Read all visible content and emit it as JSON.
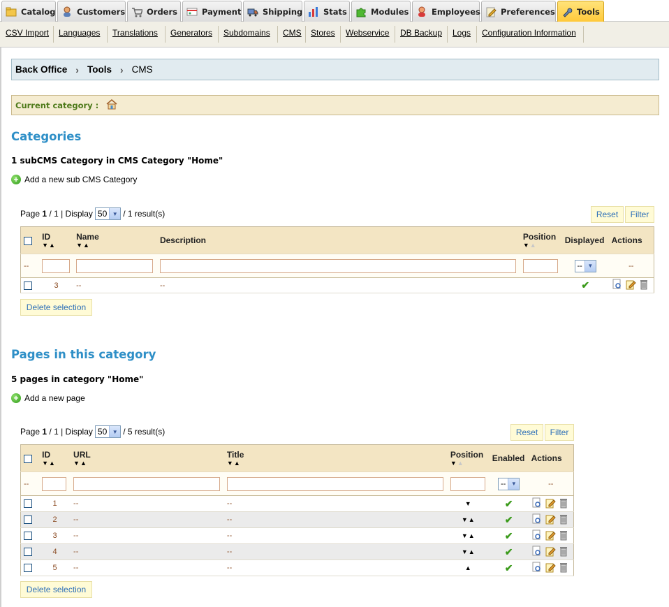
{
  "tabs": [
    {
      "label": "Catalog",
      "icon": "folder-icon",
      "active": false
    },
    {
      "label": "Customers",
      "icon": "customer-icon",
      "active": false
    },
    {
      "label": "Orders",
      "icon": "cart-icon",
      "active": false
    },
    {
      "label": "Payment",
      "icon": "payment-icon",
      "active": false
    },
    {
      "label": "Shipping",
      "icon": "truck-icon",
      "active": false
    },
    {
      "label": "Stats",
      "icon": "chart-icon",
      "active": false
    },
    {
      "label": "Modules",
      "icon": "puzzle-icon",
      "active": false
    },
    {
      "label": "Employees",
      "icon": "employee-icon",
      "active": false
    },
    {
      "label": "Preferences",
      "icon": "preferences-icon",
      "active": false
    },
    {
      "label": "Tools",
      "icon": "wrench-icon",
      "active": true
    }
  ],
  "submenu": [
    "CSV Import",
    "Languages",
    "Translations",
    "Generators",
    "Subdomains",
    "CMS",
    "Stores",
    "Webservice",
    "DB Backup",
    "Logs",
    "Configuration Information"
  ],
  "breadcrumb": {
    "level1": "Back Office",
    "level2": "Tools",
    "level3": "CMS"
  },
  "current_category": {
    "label": "Current category :",
    "icon": "home-icon"
  },
  "categories": {
    "title": "Categories",
    "summary": "1 subCMS Category in CMS Category \"Home\"",
    "add_label": "Add a new sub CMS Category",
    "pager": {
      "page_label": "Page",
      "page": "1",
      "total_pages": "/ 1 | Display",
      "display": "50",
      "results": "/ 1 result(s)"
    },
    "reset_label": "Reset",
    "filter_label": "Filter",
    "columns": {
      "id": "ID",
      "name": "Name",
      "description": "Description",
      "position": "Position",
      "displayed": "Displayed",
      "actions": "Actions"
    },
    "filter_placeholder": "--",
    "filter_select": "--",
    "rows": [
      {
        "id": "3",
        "name": "--",
        "description": "--",
        "displayed": true
      }
    ],
    "delete_label": "Delete selection"
  },
  "pages": {
    "title": "Pages in this category",
    "summary": "5 pages in category \"Home\"",
    "add_label": "Add a new page",
    "pager": {
      "page_label": "Page",
      "page": "1",
      "total_pages": "/ 1 | Display",
      "display": "50",
      "results": "/ 5 result(s)"
    },
    "reset_label": "Reset",
    "filter_label": "Filter",
    "columns": {
      "id": "ID",
      "url": "URL",
      "title": "Title",
      "position": "Position",
      "enabled": "Enabled",
      "actions": "Actions"
    },
    "filter_placeholder": "--",
    "filter_select": "--",
    "rows": [
      {
        "id": "1",
        "url": "--",
        "title": "--",
        "position": "▼",
        "enabled": true
      },
      {
        "id": "2",
        "url": "--",
        "title": "--",
        "position": "▼▲",
        "enabled": true
      },
      {
        "id": "3",
        "url": "--",
        "title": "--",
        "position": "▼▲",
        "enabled": true
      },
      {
        "id": "4",
        "url": "--",
        "title": "--",
        "position": "▼▲",
        "enabled": true
      },
      {
        "id": "5",
        "url": "--",
        "title": "--",
        "position": "▲",
        "enabled": true
      }
    ],
    "delete_label": "Delete selection"
  },
  "colors": {
    "accent": "#2e8fc7",
    "tab_active": "#ffc93a",
    "header_bg": "#f3e5c3",
    "link_brown": "#8a4a21",
    "ok_green": "#3a9a1a"
  }
}
